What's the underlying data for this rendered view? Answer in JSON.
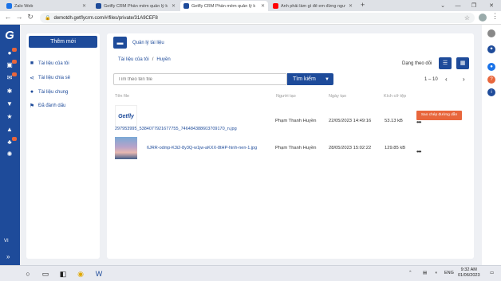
{
  "browser": {
    "tabs": [
      {
        "title": "Zalo Web",
        "favicon_color": "#1a73e8",
        "active": false
      },
      {
        "title": "Getfly CRM Phần mềm quản lý k",
        "favicon_color": "#1e4b9a",
        "active": false
      },
      {
        "title": "Getfly CRM Phần mềm quản lý k",
        "favicon_color": "#1e4b9a",
        "active": true
      },
      {
        "title": "Anh phải làm gì để em đừng ngư",
        "favicon_color": "#ff0000",
        "active": false
      }
    ],
    "url": "demotdh.getflycrm.com/#/files/private/31A9CEF8"
  },
  "left_panel": {
    "new_button": "Thêm mới",
    "items": [
      {
        "label": "Tài liệu của tôi",
        "icon": "folder-icon"
      },
      {
        "label": "Tài liệu chia sẻ",
        "icon": "share-icon"
      },
      {
        "label": "Tài liệu chung",
        "icon": "users-icon"
      },
      {
        "label": "Đã đánh dấu",
        "icon": "flag-icon"
      }
    ]
  },
  "main": {
    "title": "Quản lý tài liệu",
    "breadcrumb": [
      "Tài liệu của tôi",
      "Huyền"
    ],
    "view_label": "Dạng theo dõi",
    "search_placeholder": "Tìm theo tên file",
    "search_button": "Tìm kiếm",
    "pager": "1 – 10",
    "columns": [
      "Tên file",
      "Người tạo",
      "Ngày tạo",
      "Kích cỡ tệp"
    ],
    "rows": [
      {
        "filename": "297953995_5384077921677755_746484388603709170_n.jpg",
        "creator": "Phạm Thanh Huyền",
        "date": "22/05/2023 14:49:16",
        "size": "53.13 kB",
        "thumb_text": "Getfly",
        "action": "Sao chép đường dẫn"
      },
      {
        "filename": "6JRR-odmp-K3i2-8y3Q-w1jw-aKXX-8tHP-hinh-nen-1.jpg",
        "creator": "Phạm Thanh Huyền",
        "date": "28/05/2023 15:02:22",
        "size": "129.85 kB",
        "thumb_text": "",
        "action": ""
      }
    ]
  },
  "sidebar_lang": "VI",
  "taskbar": {
    "lang": "ENG",
    "time": "9:32 AM",
    "date": "01/06/2023"
  },
  "colors": {
    "brand": "#1e4b9a",
    "accent": "#e8663c"
  }
}
